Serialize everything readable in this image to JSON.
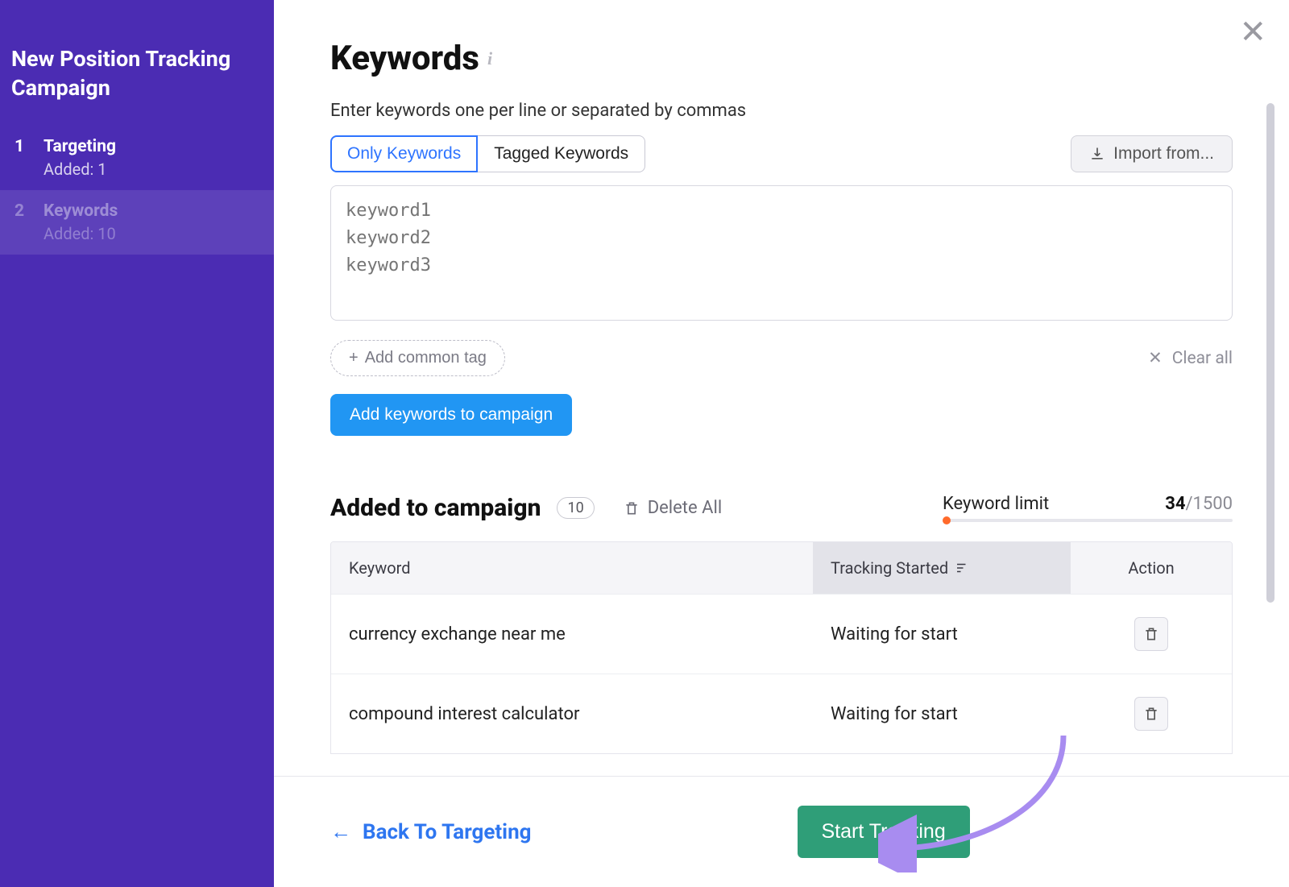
{
  "sidebar": {
    "title": "New Position Tracking Campaign",
    "steps": [
      {
        "num": "1",
        "label": "Targeting",
        "sub": "Added: 1"
      },
      {
        "num": "2",
        "label": "Keywords",
        "sub": "Added: 10"
      }
    ]
  },
  "header": {
    "title": "Keywords",
    "help": "Enter keywords one per line or separated by commas"
  },
  "tabs": {
    "only": "Only Keywords",
    "tagged": "Tagged Keywords"
  },
  "actions": {
    "import": "Import from...",
    "add_common_tag": "Add common tag",
    "clear_all": "Clear all",
    "add_to_campaign": "Add keywords to campaign",
    "delete_all": "Delete All",
    "back": "Back To Targeting",
    "start": "Start Tracking"
  },
  "textarea_placeholder": "keyword1\nkeyword2\nkeyword3",
  "added_section": {
    "title": "Added to campaign",
    "count": "10",
    "limit_label": "Keyword limit",
    "limit_used": "34",
    "limit_total": "/1500"
  },
  "table": {
    "headers": {
      "keyword": "Keyword",
      "tracking": "Tracking Started",
      "action": "Action"
    },
    "rows": [
      {
        "keyword": "currency exchange near me",
        "status": "Waiting for start"
      },
      {
        "keyword": "compound interest calculator",
        "status": "Waiting for start"
      }
    ]
  }
}
